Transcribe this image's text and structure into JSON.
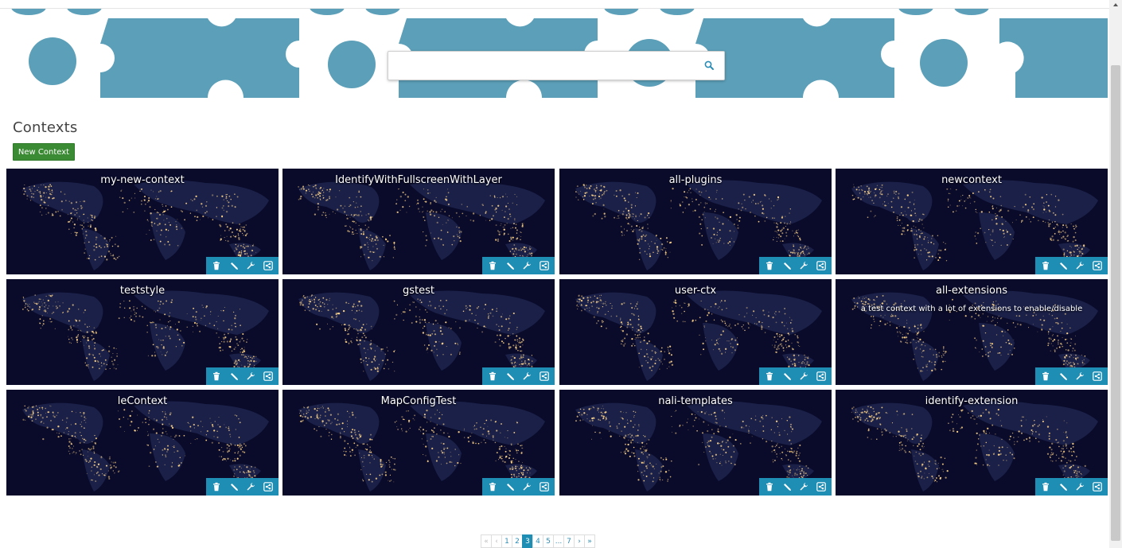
{
  "search": {
    "value": "",
    "placeholder": ""
  },
  "page_title": "Contexts",
  "new_context_label": "New Context",
  "colors": {
    "banner_blue": "#5c9fb8",
    "toolbar_blue": "#1f8eb5",
    "new_button_green": "#3b8a34"
  },
  "contexts": [
    {
      "title": "my-new-context",
      "description": ""
    },
    {
      "title": "IdentifyWithFullscreenWithLayer",
      "description": ""
    },
    {
      "title": "all-plugins",
      "description": ""
    },
    {
      "title": "newcontext",
      "description": ""
    },
    {
      "title": "teststyle",
      "description": ""
    },
    {
      "title": "gstest",
      "description": ""
    },
    {
      "title": "user-ctx",
      "description": ""
    },
    {
      "title": "all-extensions",
      "description": "a test context with a lot of extensions to enable/disable"
    },
    {
      "title": "leContext",
      "description": ""
    },
    {
      "title": "MapConfigTest",
      "description": ""
    },
    {
      "title": "nali-templates",
      "description": ""
    },
    {
      "title": "identify-extension",
      "description": ""
    }
  ],
  "card_actions": [
    "trash-icon",
    "pencil-icon",
    "wrench-icon",
    "share-icon"
  ],
  "pagination": {
    "first": "«",
    "prev": "‹",
    "pages": [
      "1",
      "2",
      "3",
      "4",
      "5",
      "...",
      "7"
    ],
    "active": "3",
    "next": "›",
    "last": "»"
  }
}
